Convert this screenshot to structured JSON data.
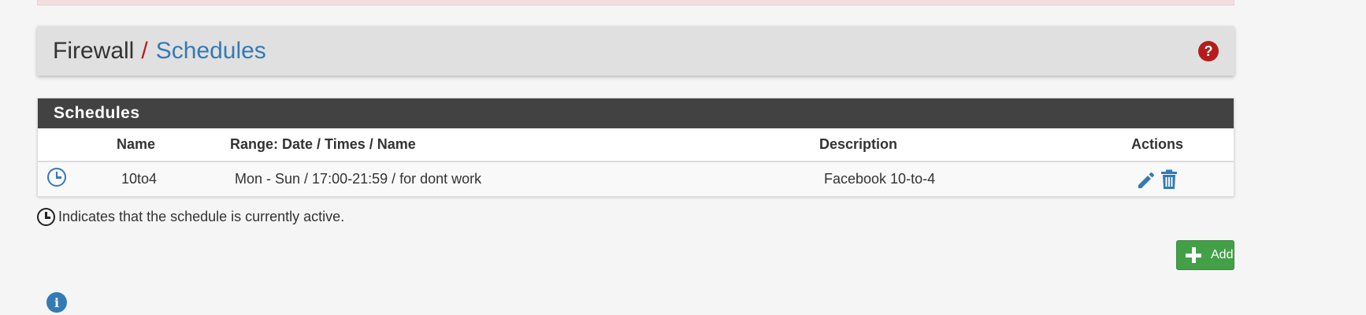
{
  "breadcrumb": {
    "first": "Firewall",
    "separator": "/",
    "current": "Schedules"
  },
  "panel": {
    "title": "Schedules",
    "columns": {
      "name": "Name",
      "range": "Range: Date / Times / Name",
      "description": "Description",
      "actions": "Actions"
    },
    "rows": [
      {
        "name": "10to4",
        "range": "Mon - Sun / 17:00-21:59 / for dont work",
        "description": "Facebook 10-to-4"
      }
    ]
  },
  "legend": {
    "text": "Indicates that the schedule is currently active."
  },
  "add_button": {
    "label": "Add"
  },
  "icons": {
    "help": "question-circle-icon",
    "active": "clock-icon",
    "edit": "pencil-icon",
    "delete": "trash-icon",
    "add": "plus-icon",
    "info": "info-circle-icon"
  },
  "colors": {
    "brand_blue": "#337ab7",
    "accent_red": "#b71c1c",
    "panel_heading": "#424242",
    "add_green": "#43a047"
  }
}
